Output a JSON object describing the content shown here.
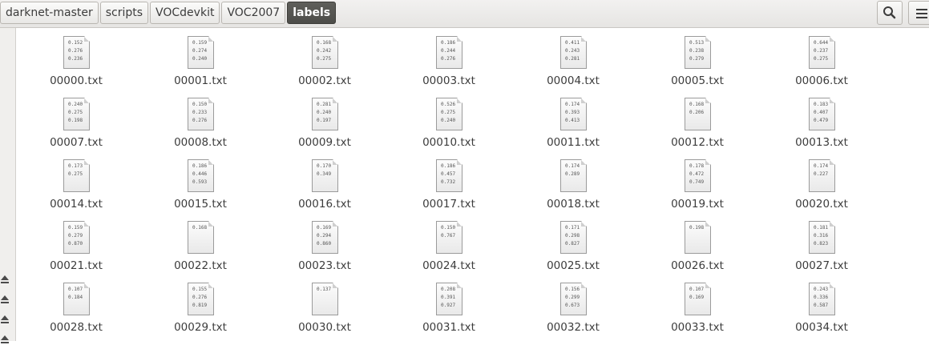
{
  "breadcrumbs": [
    "darknet-master",
    "scripts",
    "VOCdevkit",
    "VOC2007",
    "labels"
  ],
  "toolbar": {
    "search_icon": "search-icon",
    "menu_icon": "menu-icon"
  },
  "files": [
    {
      "name": "00000.txt",
      "preview": [
        "0.152",
        "0.276",
        "0.236"
      ]
    },
    {
      "name": "00001.txt",
      "preview": [
        "0.159",
        "0.274",
        "0.240"
      ]
    },
    {
      "name": "00002.txt",
      "preview": [
        "0.168",
        "0.242",
        "0.275"
      ]
    },
    {
      "name": "00003.txt",
      "preview": [
        "0.186",
        "0.244",
        "0.276"
      ]
    },
    {
      "name": "00004.txt",
      "preview": [
        "0.411",
        "0.243",
        "0.281"
      ]
    },
    {
      "name": "00005.txt",
      "preview": [
        "0.513",
        "0.238",
        "0.279"
      ]
    },
    {
      "name": "00006.txt",
      "preview": [
        "0.644",
        "0.237",
        "0.275"
      ]
    },
    {
      "name": "00007.txt",
      "preview": [
        "0.240",
        "0.275",
        "0.198"
      ]
    },
    {
      "name": "00008.txt",
      "preview": [
        "0.150",
        "0.233",
        "0.276"
      ]
    },
    {
      "name": "00009.txt",
      "preview": [
        "0.281",
        "0.240",
        "0.197"
      ]
    },
    {
      "name": "00010.txt",
      "preview": [
        "0.526",
        "0.275",
        "0.240"
      ]
    },
    {
      "name": "00011.txt",
      "preview": [
        "0.174",
        "0.393",
        "0.413"
      ]
    },
    {
      "name": "00012.txt",
      "preview": [
        "0.168",
        "0.206"
      ]
    },
    {
      "name": "00013.txt",
      "preview": [
        "0.183",
        "0.407",
        "0.479"
      ]
    },
    {
      "name": "00014.txt",
      "preview": [
        "0.173",
        "0.275"
      ]
    },
    {
      "name": "00015.txt",
      "preview": [
        "0.186",
        "0.446",
        "0.593"
      ]
    },
    {
      "name": "00016.txt",
      "preview": [
        "0.170",
        "0.349"
      ]
    },
    {
      "name": "00017.txt",
      "preview": [
        "0.186",
        "0.457",
        "0.732"
      ]
    },
    {
      "name": "00018.txt",
      "preview": [
        "0.174",
        "0.289"
      ]
    },
    {
      "name": "00019.txt",
      "preview": [
        "0.178",
        "0.472",
        "0.749"
      ]
    },
    {
      "name": "00020.txt",
      "preview": [
        "0.174",
        "0.227"
      ]
    },
    {
      "name": "00021.txt",
      "preview": [
        "0.159",
        "0.279",
        "0.870"
      ]
    },
    {
      "name": "00022.txt",
      "preview": [
        "0.168"
      ]
    },
    {
      "name": "00023.txt",
      "preview": [
        "0.169",
        "0.294",
        "0.860"
      ]
    },
    {
      "name": "00024.txt",
      "preview": [
        "0.150",
        "0.767"
      ]
    },
    {
      "name": "00025.txt",
      "preview": [
        "0.171",
        "0.298",
        "0.827"
      ]
    },
    {
      "name": "00026.txt",
      "preview": [
        "0.198"
      ]
    },
    {
      "name": "00027.txt",
      "preview": [
        "0.181",
        "0.316",
        "0.823"
      ]
    },
    {
      "name": "00028.txt",
      "preview": [
        "0.107",
        "0.184"
      ]
    },
    {
      "name": "00029.txt",
      "preview": [
        "0.155",
        "0.276",
        "0.819"
      ]
    },
    {
      "name": "00030.txt",
      "preview": [
        "0.137"
      ]
    },
    {
      "name": "00031.txt",
      "preview": [
        "0.208",
        "0.391",
        "0.927"
      ]
    },
    {
      "name": "00032.txt",
      "preview": [
        "0.156",
        "0.299",
        "0.673"
      ]
    },
    {
      "name": "00033.txt",
      "preview": [
        "0.107",
        "0.169"
      ]
    },
    {
      "name": "00034.txt",
      "preview": [
        "0.243",
        "0.336",
        "0.587"
      ]
    }
  ]
}
